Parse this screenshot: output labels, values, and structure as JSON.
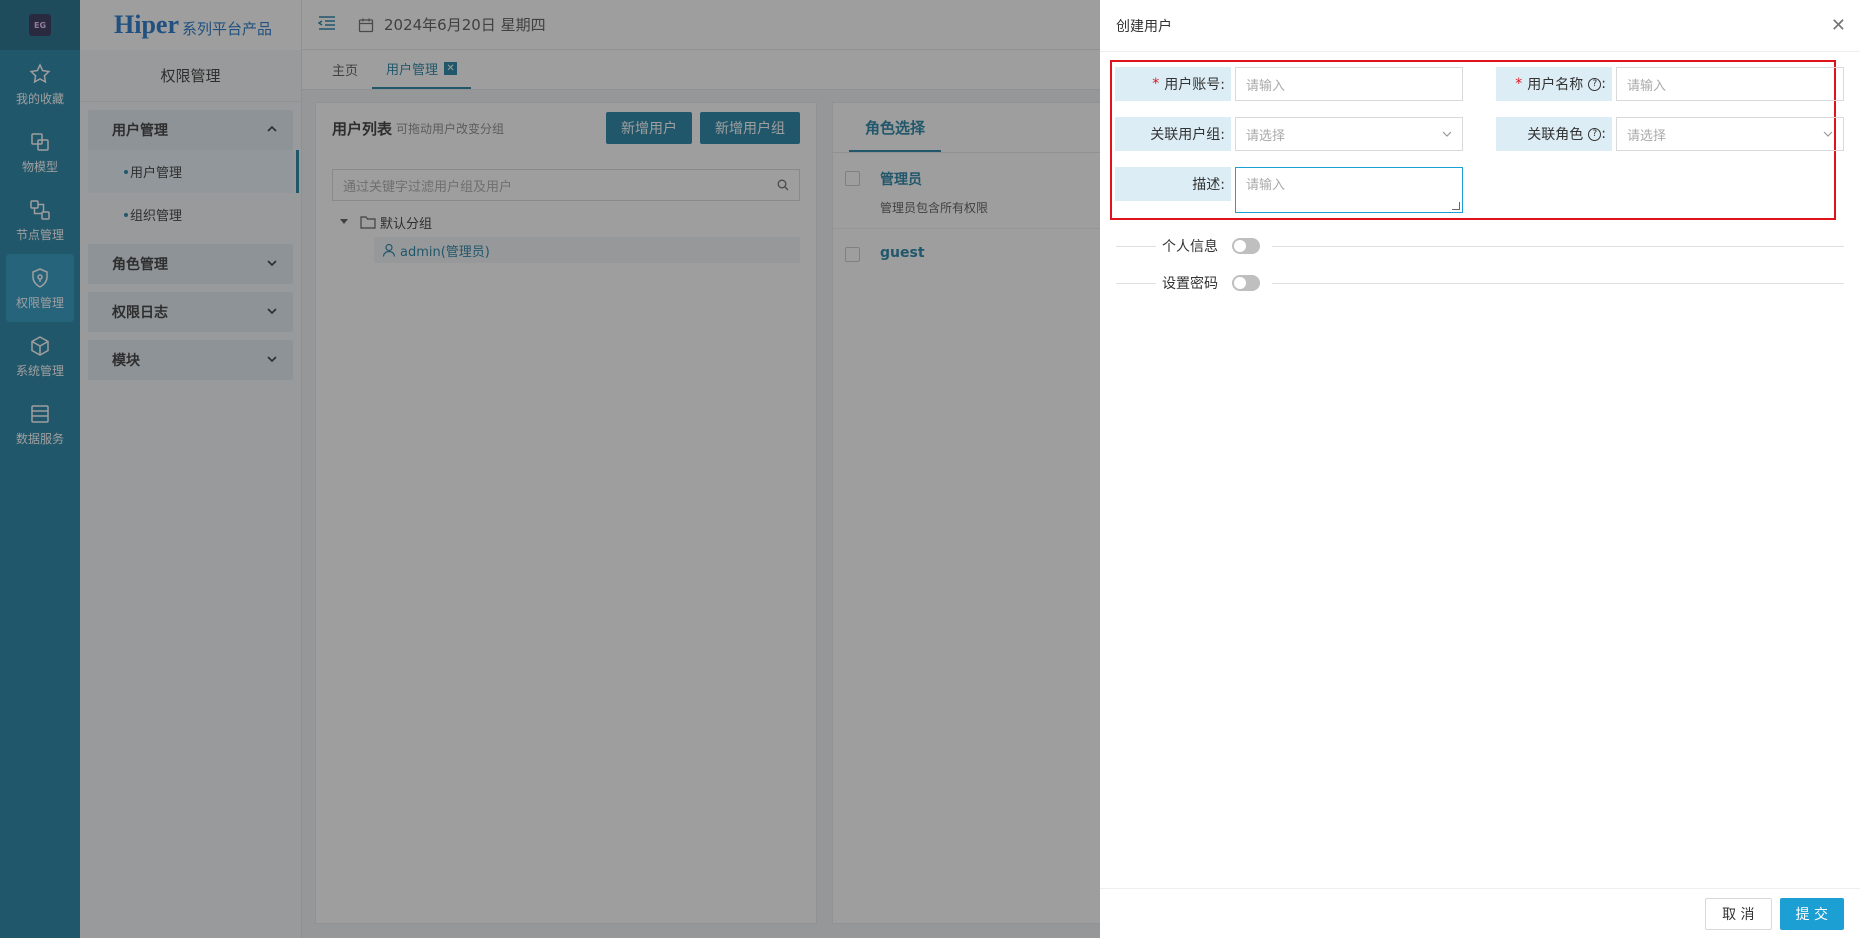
{
  "rail": {
    "logo_text": "EG",
    "items": [
      {
        "label": "我的收藏",
        "icon": "star-icon"
      },
      {
        "label": "物模型",
        "icon": "model-icon"
      },
      {
        "label": "节点管理",
        "icon": "node-icon"
      },
      {
        "label": "权限管理",
        "icon": "shield-icon"
      },
      {
        "label": "系统管理",
        "icon": "cube-icon"
      },
      {
        "label": "数据服务",
        "icon": "database-icon"
      }
    ]
  },
  "brand": {
    "name": "Hiper",
    "sub": "系列平台产品"
  },
  "menu": {
    "title": "权限管理",
    "groups": {
      "user": "用户管理",
      "user_sub": [
        "用户管理",
        "组织管理"
      ],
      "role": "角色管理",
      "log": "权限日志",
      "module": "模块"
    }
  },
  "header": {
    "date": "2024年6月20日 星期四"
  },
  "tabs": [
    {
      "label": "主页"
    },
    {
      "label": "用户管理"
    }
  ],
  "user_list": {
    "title": "用户列表",
    "hint": "可拖动用户改变分组",
    "btn_add_user": "新增用户",
    "btn_add_group": "新增用户组",
    "search_placeholder": "通过关键字过滤用户组及用户",
    "group": "默认分组",
    "user": "admin(管理员)"
  },
  "role_select": {
    "title": "角色选择",
    "roles": [
      {
        "name": "管理员",
        "desc": "管理员包含所有权限"
      },
      {
        "name": "guest",
        "desc": ""
      }
    ]
  },
  "drawer": {
    "title": "创建用户",
    "fields": {
      "account_label": "用户账号:",
      "account_placeholder": "请输入",
      "name_label": "用户名称",
      "name_colon": ":",
      "name_placeholder": "请输入",
      "group_label": "关联用户组:",
      "group_placeholder": "请选择",
      "role_label": "关联角色",
      "role_colon": ":",
      "role_placeholder": "请选择",
      "desc_label": "描述:",
      "desc_placeholder": "请输入"
    },
    "sections": {
      "personal": "个人信息",
      "password": "设置密码"
    },
    "cancel": "取 消",
    "submit": "提 交"
  },
  "colors": {
    "primary": "#1c7fa3",
    "highlight_border": "#e0121b",
    "submit": "#1c9fd3"
  }
}
